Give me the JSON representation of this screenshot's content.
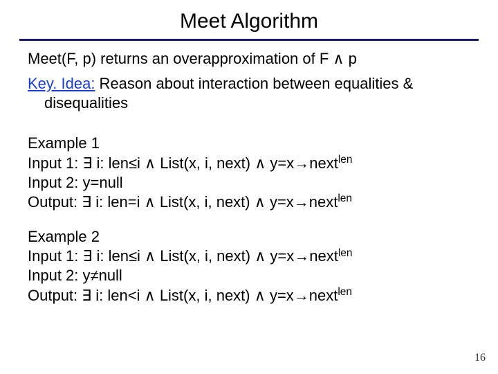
{
  "title": "Meet Algorithm",
  "intro": {
    "meet": "Meet(F, p) returns an overapproximation of F ∧ p",
    "keyidea_label": "Key. Idea:",
    "keyidea_rest": " Reason about interaction between equalities & disequalities"
  },
  "example1": {
    "heading": "Example 1",
    "input1": "Input 1: ∃ i: len≤i ∧ List(x, i, next) ∧ y=x→next",
    "input1_sup": "len",
    "input2": "Input 2: y=null",
    "output": "Output: ∃ i: len=i ∧ List(x, i, next) ∧ y=x→next",
    "output_sup": "len"
  },
  "example2": {
    "heading": "Example 2",
    "input1": "Input 1: ∃ i: len≤i ∧ List(x, i, next) ∧ y=x→next",
    "input1_sup": "len",
    "input2": "Input 2: y≠null",
    "output": "Output: ∃ i: len<i ∧ List(x, i, next) ∧ y=x→next",
    "output_sup": "len"
  },
  "page_number": "16"
}
